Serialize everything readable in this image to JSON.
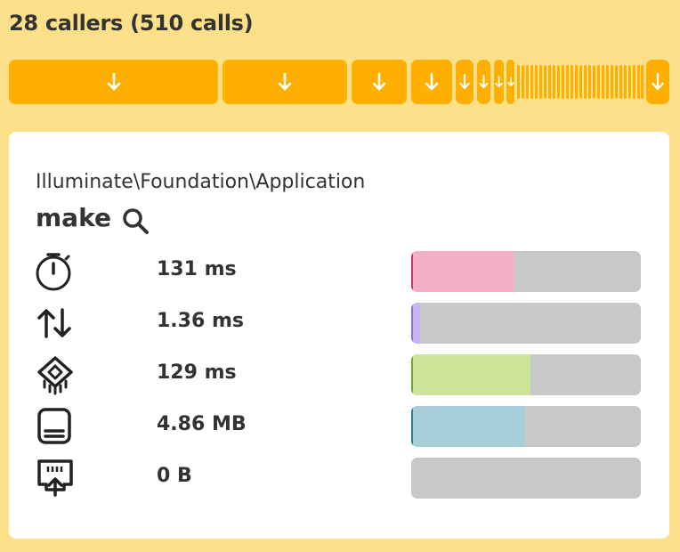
{
  "header": {
    "title": "28 callers (510 calls)"
  },
  "callers": {
    "segment_icon": "arrow-down-icon",
    "color": "#ffaf00"
  },
  "details": {
    "namespace": "Illuminate\\Foundation\\Application",
    "function_name": "make",
    "search_icon": "search-icon",
    "metrics": [
      {
        "icon": "stopwatch-icon",
        "value": "131 ms",
        "fraction": 0.44,
        "color": "#f3b0c9",
        "edge": "#c0395f"
      },
      {
        "icon": "io-arrows-icon",
        "value": "1.36 ms",
        "fraction": 0.03,
        "color": "#c9b5ef",
        "edge": "#8e6fd6"
      },
      {
        "icon": "cpu-chip-icon",
        "value": "129 ms",
        "fraction": 0.51,
        "color": "#cce39a",
        "edge": "#6fa32a"
      },
      {
        "icon": "memory-icon",
        "value": "4.86 MB",
        "fraction": 0.49,
        "color": "#a8ceda",
        "edge": "#2f7a92"
      },
      {
        "icon": "network-icon",
        "value": "0 B",
        "fraction": 0.0,
        "color": "#c8c8c8",
        "edge": "#c8c8c8"
      }
    ]
  }
}
